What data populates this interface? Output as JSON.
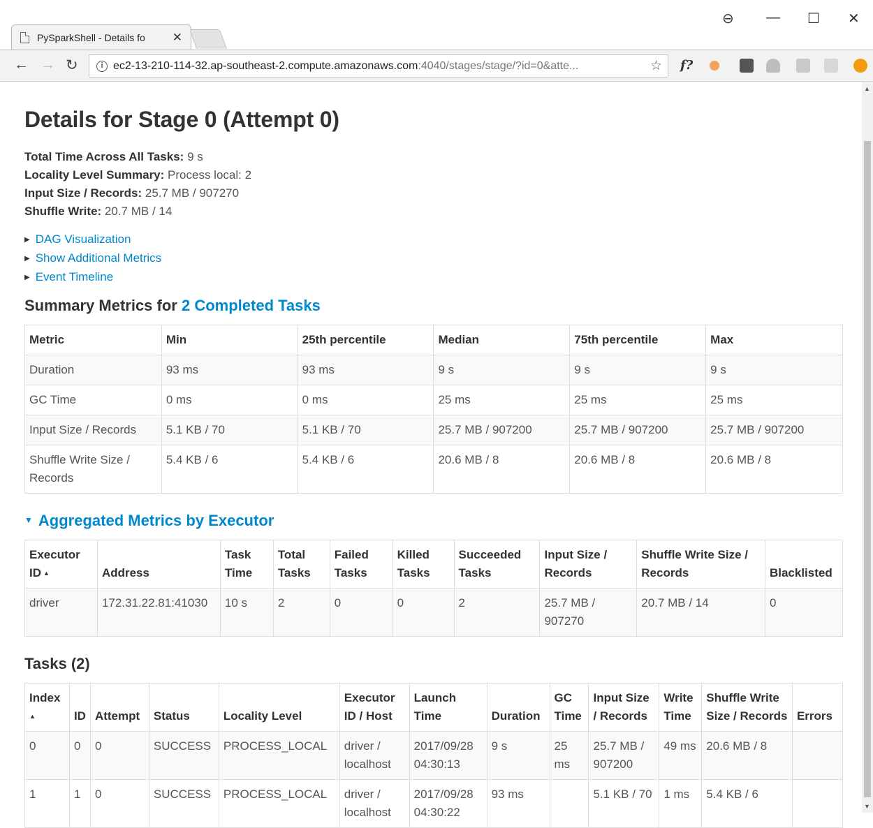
{
  "browser": {
    "tab_title": "PySparkShell - Details fo",
    "tab_close": "✕",
    "url_host": "ec2-13-210-114-32.ap-southeast-2.compute.amazonaws.com",
    "url_rest": ":4040/stages/stage/?id=0&atte...",
    "ext_f": "f?",
    "colors": {
      "accent_link": "#0088cc"
    }
  },
  "page": {
    "title": "Details for Stage 0 (Attempt 0)",
    "summary": [
      {
        "label": "Total Time Across All Tasks:",
        "value": "9 s"
      },
      {
        "label": "Locality Level Summary:",
        "value": "Process local: 2"
      },
      {
        "label": "Input Size / Records:",
        "value": "25.7 MB / 907270"
      },
      {
        "label": "Shuffle Write:",
        "value": "20.7 MB / 14"
      }
    ],
    "links": [
      "DAG Visualization",
      "Show Additional Metrics",
      "Event Timeline"
    ],
    "summary_metrics_prefix": "Summary Metrics for",
    "summary_metrics_link": "2 Completed Tasks",
    "aggregated_title": "Aggregated Metrics by Executor",
    "tasks_title": "Tasks (2)"
  },
  "metrics_table": {
    "headers": [
      "Metric",
      "Min",
      "25th percentile",
      "Median",
      "75th percentile",
      "Max"
    ],
    "rows": [
      [
        "Duration",
        "93 ms",
        "93 ms",
        "9 s",
        "9 s",
        "9 s"
      ],
      [
        "GC Time",
        "0 ms",
        "0 ms",
        "25 ms",
        "25 ms",
        "25 ms"
      ],
      [
        "Input Size / Records",
        "5.1 KB / 70",
        "5.1 KB / 70",
        "25.7 MB / 907200",
        "25.7 MB / 907200",
        "25.7 MB / 907200"
      ],
      [
        "Shuffle Write Size / Records",
        "5.4 KB / 6",
        "5.4 KB / 6",
        "20.6 MB / 8",
        "20.6 MB / 8",
        "20.6 MB / 8"
      ]
    ]
  },
  "executor_table": {
    "headers": [
      "Executor ID",
      "Address",
      "Task Time",
      "Total Tasks",
      "Failed Tasks",
      "Killed Tasks",
      "Succeeded Tasks",
      "Input Size / Records",
      "Shuffle Write Size / Records",
      "Blacklisted"
    ],
    "sort_arrow": "▲",
    "rows": [
      [
        "driver",
        "172.31.22.81:41030",
        "10 s",
        "2",
        "0",
        "0",
        "2",
        "25.7 MB / 907270",
        "20.7 MB / 14",
        "0"
      ]
    ]
  },
  "tasks_table": {
    "headers": [
      "Index",
      "ID",
      "Attempt",
      "Status",
      "Locality Level",
      "Executor ID / Host",
      "Launch Time",
      "Duration",
      "GC Time",
      "Input Size / Records",
      "Write Time",
      "Shuffle Write Size / Records",
      "Errors"
    ],
    "sort_arrow": "▲",
    "rows": [
      [
        "0",
        "0",
        "0",
        "SUCCESS",
        "PROCESS_LOCAL",
        "driver / localhost",
        "2017/09/28 04:30:13",
        "9 s",
        "25 ms",
        "25.7 MB / 907200",
        "49 ms",
        "20.6 MB / 8",
        ""
      ],
      [
        "1",
        "1",
        "0",
        "SUCCESS",
        "PROCESS_LOCAL",
        "driver / localhost",
        "2017/09/28 04:30:22",
        "93 ms",
        "",
        "5.1 KB / 70",
        "1 ms",
        "5.4 KB / 6",
        ""
      ]
    ]
  }
}
